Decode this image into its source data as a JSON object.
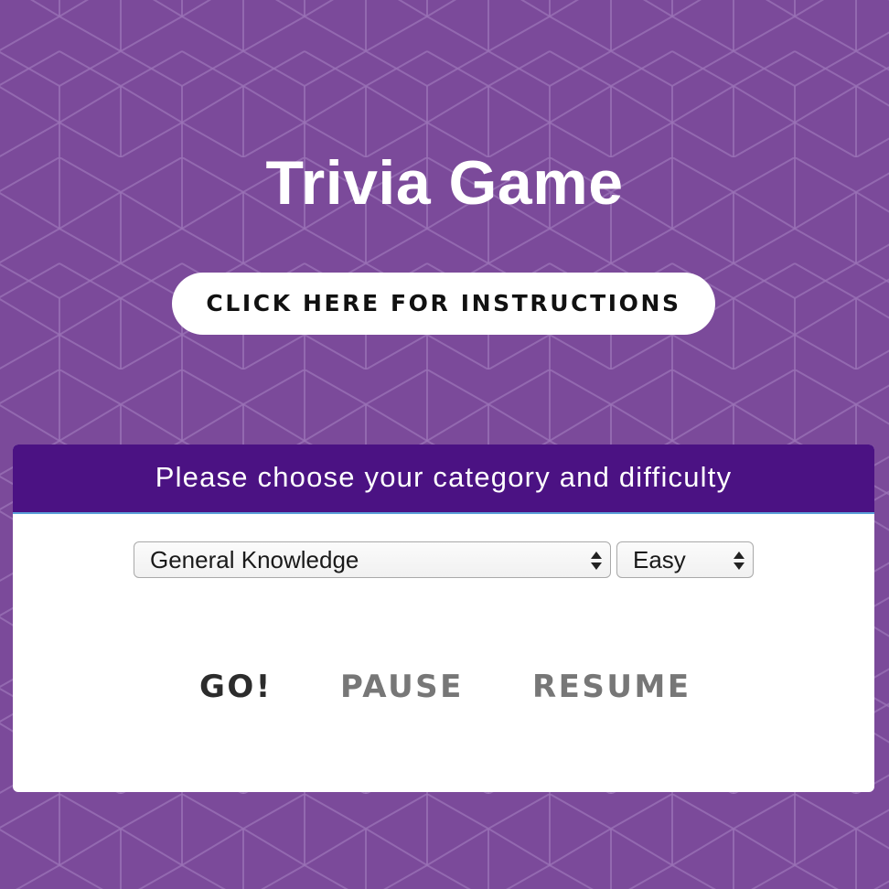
{
  "page": {
    "title": "Trivia Game",
    "background_color": "#7b4a9a",
    "pattern": "hexagonal-cube-lines"
  },
  "instructions_button": {
    "label": "CLICK HERE FOR INSTRUCTIONS"
  },
  "panel": {
    "header_text": "Please choose your category and difficulty",
    "header_color": "#4b1283",
    "category_select": {
      "selected": "General Knowledge",
      "icon": "select-arrows-icon"
    },
    "difficulty_select": {
      "selected": "Easy",
      "icon": "select-arrows-icon"
    },
    "actions": {
      "go_label": "GO!",
      "pause_label": "PAUSE",
      "resume_label": "RESUME"
    }
  }
}
